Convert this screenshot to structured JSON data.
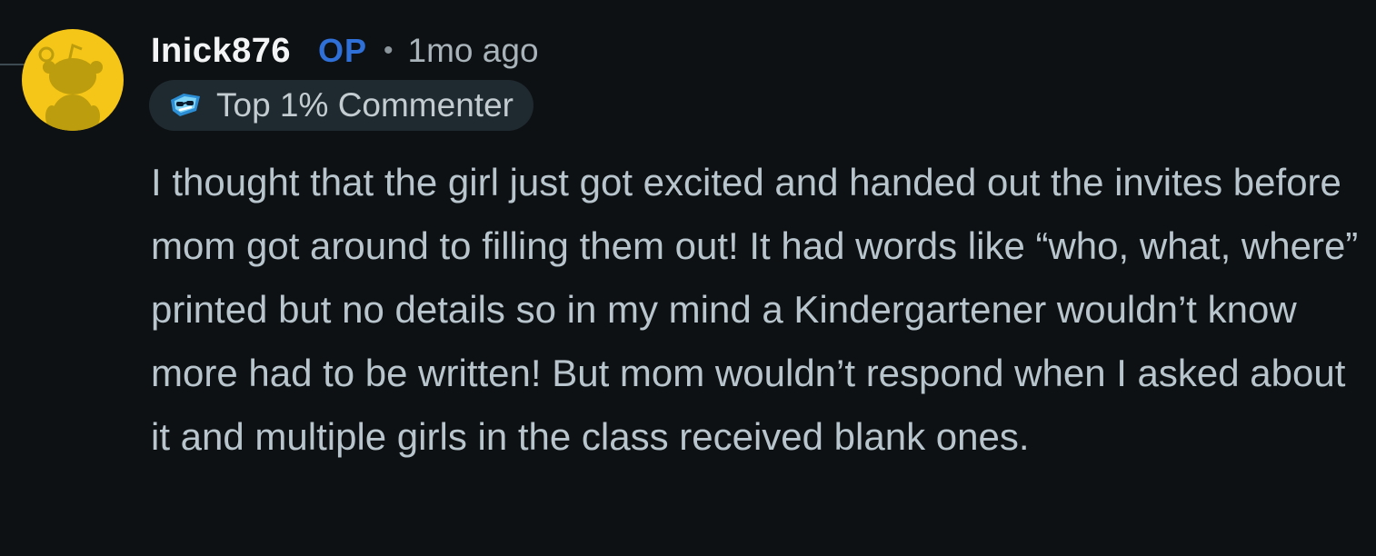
{
  "comment": {
    "username": "Inick876",
    "op_badge": "OP",
    "separator": "•",
    "timestamp": "1mo ago",
    "flair": {
      "icon": "top-commenter-icon",
      "label": "Top 1% Commenter"
    },
    "body": "I thought that the girl just got excited and handed out the invites before mom got around to filling them out! It had words like “who, what, where” printed but no details so in my mind a Kindergartener wouldn’t know more had to be written! But mom wouldn’t respond when I asked about it and multiple girls in the class received blank ones."
  },
  "avatar": {
    "icon": "snoo-avatar-icon",
    "background": "#f5c518"
  },
  "colors": {
    "background": "#0e1113",
    "username": "#f2f4f5",
    "op": "#2f6fd8",
    "meta": "#a8b3ba",
    "body_text": "#b8c5cd",
    "flair_bg": "#1f2a30"
  }
}
